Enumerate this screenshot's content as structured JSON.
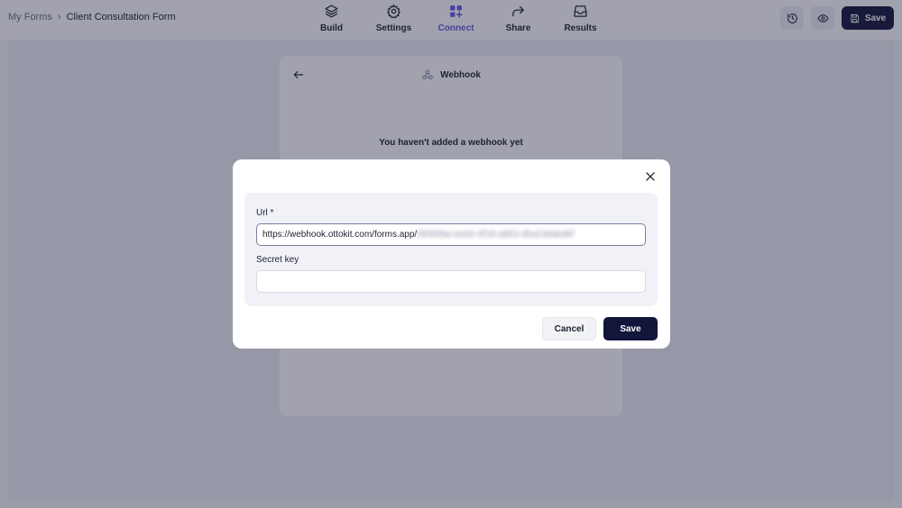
{
  "breadcrumb": {
    "root": "My Forms",
    "separator": "›",
    "current": "Client Consultation Form"
  },
  "nav": {
    "items": [
      {
        "label": "Build",
        "icon": "layers-icon"
      },
      {
        "label": "Settings",
        "icon": "gear-icon"
      },
      {
        "label": "Connect",
        "icon": "apps-add-icon",
        "active": true
      },
      {
        "label": "Share",
        "icon": "share-arrow-icon"
      },
      {
        "label": "Results",
        "icon": "inbox-icon"
      }
    ]
  },
  "toolbar": {
    "history_icon": "history-icon",
    "preview_icon": "eye-icon",
    "save_label": "Save"
  },
  "panel": {
    "title": "Webhook",
    "empty_message": "You haven't added a webhook yet"
  },
  "modal": {
    "url_label": "Url *",
    "url_value_visible": "https://webhook.ottokit.com/forms.app/",
    "url_value_redacted": "f3093fae-bcb0-4f18-a863-d5a23dabd6f",
    "secret_label": "Secret key",
    "secret_value": "",
    "cancel_label": "Cancel",
    "save_label": "Save"
  },
  "colors": {
    "accent": "#6b55e6",
    "primary_button": "#12163a",
    "overlay": "#1e223e"
  }
}
